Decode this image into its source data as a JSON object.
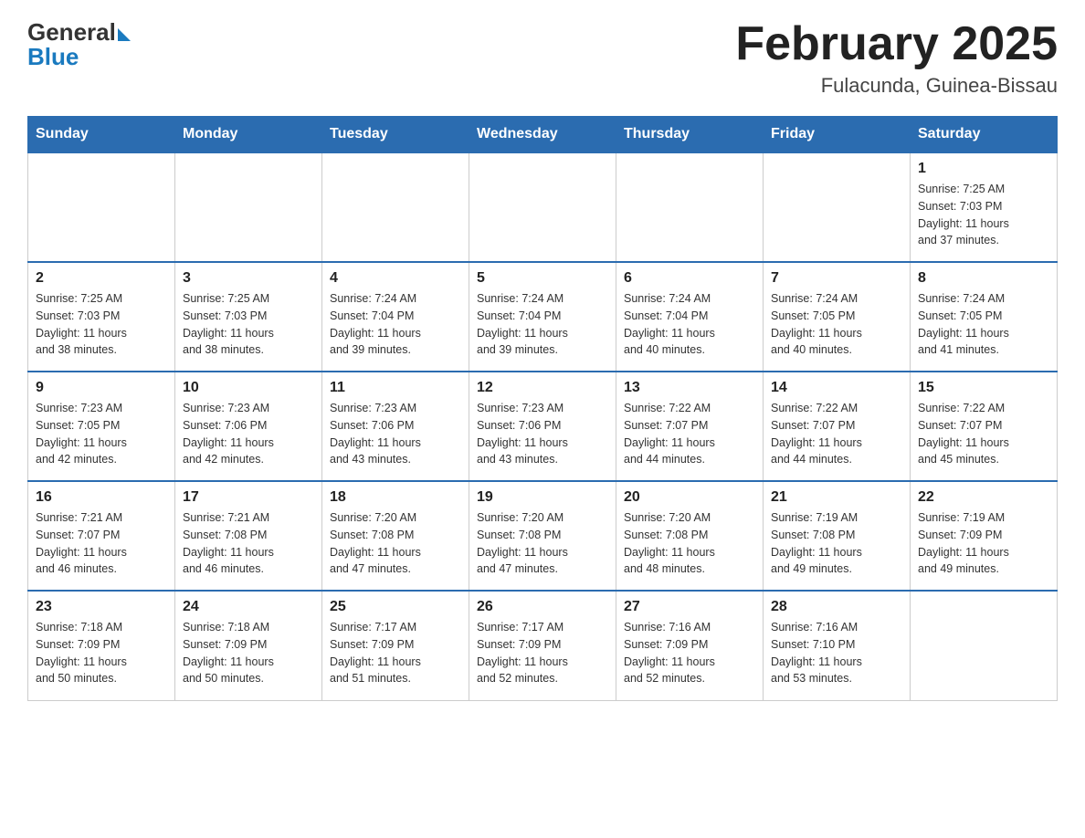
{
  "logo": {
    "general": "General",
    "blue": "Blue"
  },
  "title": "February 2025",
  "subtitle": "Fulacunda, Guinea-Bissau",
  "days_of_week": [
    "Sunday",
    "Monday",
    "Tuesday",
    "Wednesday",
    "Thursday",
    "Friday",
    "Saturday"
  ],
  "weeks": [
    [
      {
        "day": "",
        "info": ""
      },
      {
        "day": "",
        "info": ""
      },
      {
        "day": "",
        "info": ""
      },
      {
        "day": "",
        "info": ""
      },
      {
        "day": "",
        "info": ""
      },
      {
        "day": "",
        "info": ""
      },
      {
        "day": "1",
        "info": "Sunrise: 7:25 AM\nSunset: 7:03 PM\nDaylight: 11 hours\nand 37 minutes."
      }
    ],
    [
      {
        "day": "2",
        "info": "Sunrise: 7:25 AM\nSunset: 7:03 PM\nDaylight: 11 hours\nand 38 minutes."
      },
      {
        "day": "3",
        "info": "Sunrise: 7:25 AM\nSunset: 7:03 PM\nDaylight: 11 hours\nand 38 minutes."
      },
      {
        "day": "4",
        "info": "Sunrise: 7:24 AM\nSunset: 7:04 PM\nDaylight: 11 hours\nand 39 minutes."
      },
      {
        "day": "5",
        "info": "Sunrise: 7:24 AM\nSunset: 7:04 PM\nDaylight: 11 hours\nand 39 minutes."
      },
      {
        "day": "6",
        "info": "Sunrise: 7:24 AM\nSunset: 7:04 PM\nDaylight: 11 hours\nand 40 minutes."
      },
      {
        "day": "7",
        "info": "Sunrise: 7:24 AM\nSunset: 7:05 PM\nDaylight: 11 hours\nand 40 minutes."
      },
      {
        "day": "8",
        "info": "Sunrise: 7:24 AM\nSunset: 7:05 PM\nDaylight: 11 hours\nand 41 minutes."
      }
    ],
    [
      {
        "day": "9",
        "info": "Sunrise: 7:23 AM\nSunset: 7:05 PM\nDaylight: 11 hours\nand 42 minutes."
      },
      {
        "day": "10",
        "info": "Sunrise: 7:23 AM\nSunset: 7:06 PM\nDaylight: 11 hours\nand 42 minutes."
      },
      {
        "day": "11",
        "info": "Sunrise: 7:23 AM\nSunset: 7:06 PM\nDaylight: 11 hours\nand 43 minutes."
      },
      {
        "day": "12",
        "info": "Sunrise: 7:23 AM\nSunset: 7:06 PM\nDaylight: 11 hours\nand 43 minutes."
      },
      {
        "day": "13",
        "info": "Sunrise: 7:22 AM\nSunset: 7:07 PM\nDaylight: 11 hours\nand 44 minutes."
      },
      {
        "day": "14",
        "info": "Sunrise: 7:22 AM\nSunset: 7:07 PM\nDaylight: 11 hours\nand 44 minutes."
      },
      {
        "day": "15",
        "info": "Sunrise: 7:22 AM\nSunset: 7:07 PM\nDaylight: 11 hours\nand 45 minutes."
      }
    ],
    [
      {
        "day": "16",
        "info": "Sunrise: 7:21 AM\nSunset: 7:07 PM\nDaylight: 11 hours\nand 46 minutes."
      },
      {
        "day": "17",
        "info": "Sunrise: 7:21 AM\nSunset: 7:08 PM\nDaylight: 11 hours\nand 46 minutes."
      },
      {
        "day": "18",
        "info": "Sunrise: 7:20 AM\nSunset: 7:08 PM\nDaylight: 11 hours\nand 47 minutes."
      },
      {
        "day": "19",
        "info": "Sunrise: 7:20 AM\nSunset: 7:08 PM\nDaylight: 11 hours\nand 47 minutes."
      },
      {
        "day": "20",
        "info": "Sunrise: 7:20 AM\nSunset: 7:08 PM\nDaylight: 11 hours\nand 48 minutes."
      },
      {
        "day": "21",
        "info": "Sunrise: 7:19 AM\nSunset: 7:08 PM\nDaylight: 11 hours\nand 49 minutes."
      },
      {
        "day": "22",
        "info": "Sunrise: 7:19 AM\nSunset: 7:09 PM\nDaylight: 11 hours\nand 49 minutes."
      }
    ],
    [
      {
        "day": "23",
        "info": "Sunrise: 7:18 AM\nSunset: 7:09 PM\nDaylight: 11 hours\nand 50 minutes."
      },
      {
        "day": "24",
        "info": "Sunrise: 7:18 AM\nSunset: 7:09 PM\nDaylight: 11 hours\nand 50 minutes."
      },
      {
        "day": "25",
        "info": "Sunrise: 7:17 AM\nSunset: 7:09 PM\nDaylight: 11 hours\nand 51 minutes."
      },
      {
        "day": "26",
        "info": "Sunrise: 7:17 AM\nSunset: 7:09 PM\nDaylight: 11 hours\nand 52 minutes."
      },
      {
        "day": "27",
        "info": "Sunrise: 7:16 AM\nSunset: 7:09 PM\nDaylight: 11 hours\nand 52 minutes."
      },
      {
        "day": "28",
        "info": "Sunrise: 7:16 AM\nSunset: 7:10 PM\nDaylight: 11 hours\nand 53 minutes."
      },
      {
        "day": "",
        "info": ""
      }
    ]
  ]
}
